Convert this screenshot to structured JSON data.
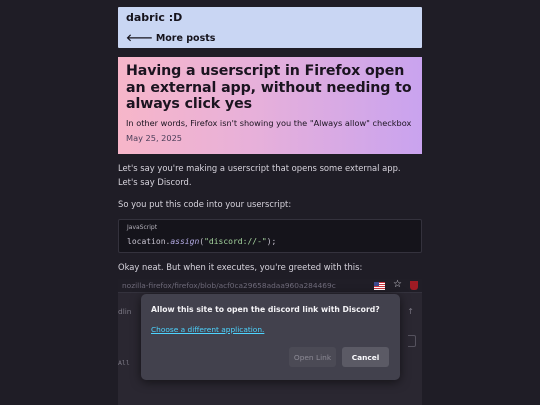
{
  "header": {
    "site_title": "dabric :D",
    "back_arrow": "🡐",
    "more_posts": "More posts"
  },
  "post": {
    "title": "Having a userscript in Firefox open an external app, without needing to always click yes",
    "subtitle": "In other words, Firefox isn't showing you the \"Always allow\" checkbox",
    "date": "May 25, 2025",
    "paragraph1": "Let's say you're making a userscript that opens some external app. Let's say Discord.",
    "paragraph2": "So you put this code into your userscript:",
    "paragraph3": "Okay neat. But when it executes, you're greeted with this:"
  },
  "code_block": {
    "language": "JavaScript",
    "tok_object": "location",
    "tok_dot": ".",
    "tok_method": "assign",
    "tok_open": "(",
    "tok_string": "\"discord://-\"",
    "tok_close": ");"
  },
  "screenshot": {
    "url_text": "nozilla-firefox/firefox/blob/acf0ca29658adaa960a284469c",
    "row_a_text": "dlin",
    "row_b_text": "All",
    "icons": [
      "us-flag-icon",
      "star-icon",
      "ublock-icon"
    ]
  },
  "dialog": {
    "title": "Allow this site to open the discord link with Discord?",
    "choose_link": "Choose a different application.",
    "open_button": "Open Link",
    "cancel_button": "Cancel"
  },
  "colors": {
    "page_bg": "#1f1d26",
    "header_bg": "#c9d6f3",
    "hero_gradient_start": "#f7b6c9",
    "hero_gradient_end": "#c9a3ef",
    "dialog_bg": "#42414d",
    "link_color": "#4dd4ff"
  }
}
